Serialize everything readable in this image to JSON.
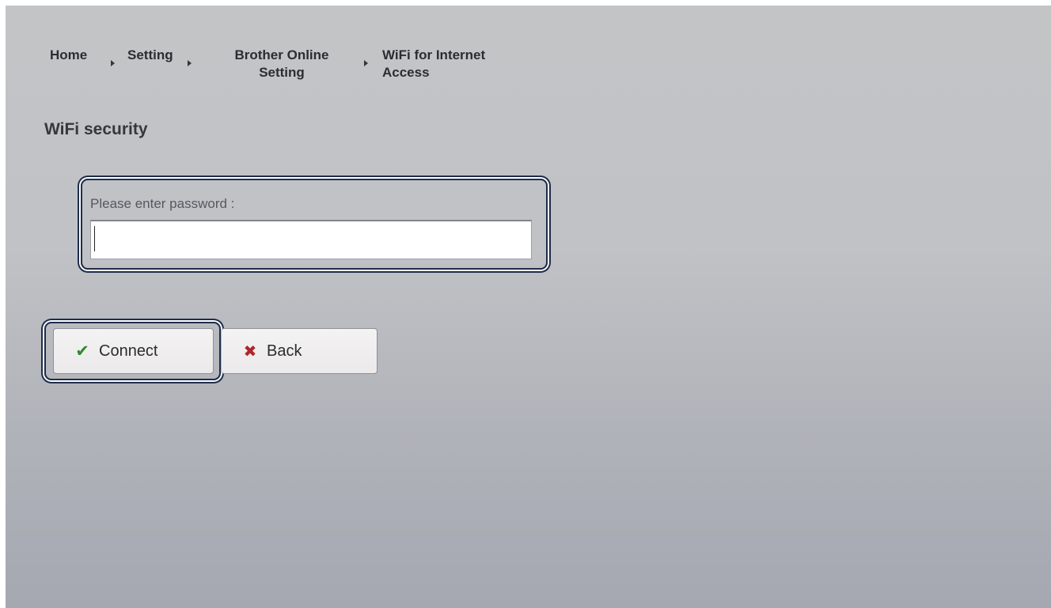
{
  "breadcrumb": {
    "items": [
      {
        "label": "Home"
      },
      {
        "label": "Setting"
      },
      {
        "label_line1": "Brother Online",
        "label_line2": "Setting"
      },
      {
        "label_line1": "WiFi for Internet",
        "label_line2": "Access"
      }
    ]
  },
  "page": {
    "title": "WiFi security"
  },
  "password": {
    "label": "Please enter password :",
    "value": "",
    "placeholder": ""
  },
  "buttons": {
    "connect_label": "Connect",
    "back_label": "Back"
  },
  "icons": {
    "connect": "check-icon",
    "back": "close-icon"
  },
  "colors": {
    "check": "#2f8a2c",
    "cross": "#b0252c",
    "focus_ring": "#1f2d4a"
  }
}
